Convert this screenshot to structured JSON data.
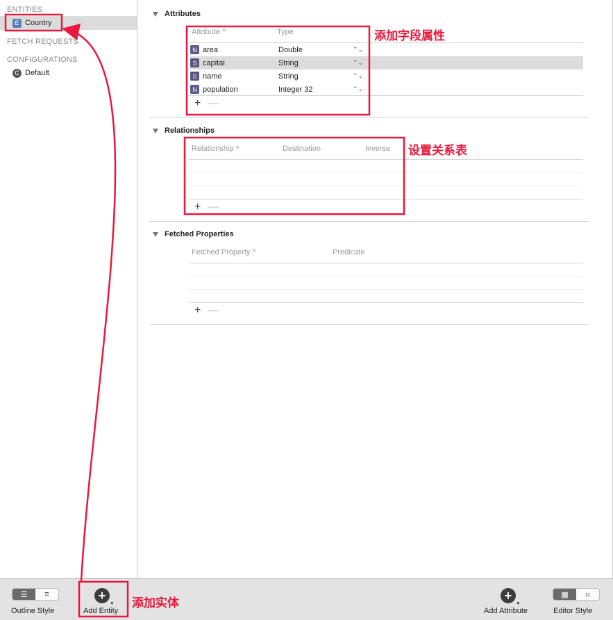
{
  "sidebar": {
    "entities_header": "ENTITIES",
    "entities": [
      {
        "label": "Country",
        "badge": "E",
        "selected": true
      }
    ],
    "fetch_requests_header": "FETCH REQUESTS",
    "configurations_header": "CONFIGURATIONS",
    "configurations": [
      {
        "label": "Default",
        "badge": "C"
      }
    ]
  },
  "attributes": {
    "title": "Attributes",
    "columns": [
      "Attribute",
      "Type"
    ],
    "rows": [
      {
        "badge": "N",
        "name": "area",
        "type": "Double"
      },
      {
        "badge": "S",
        "name": "capital",
        "type": "String",
        "selected": true
      },
      {
        "badge": "S",
        "name": "name",
        "type": "String"
      },
      {
        "badge": "N",
        "name": "population",
        "type": "Integer 32"
      }
    ],
    "add": "+",
    "remove": "—"
  },
  "relationships": {
    "title": "Relationships",
    "columns": [
      "Relationship",
      "Destination",
      "Inverse"
    ],
    "add": "+",
    "remove": "—"
  },
  "fetched": {
    "title": "Fetched Properties",
    "columns": [
      "Fetched Property",
      "Predicate"
    ],
    "add": "+",
    "remove": "—"
  },
  "sort_indicator": "^",
  "stepper_icon": "⌃⌄",
  "toolbar": {
    "outline_style": "Outline Style",
    "add_entity": "Add Entity",
    "add_attribute": "Add Attribute",
    "editor_style": "Editor Style"
  },
  "annotations": {
    "attributes": "添加字段属性",
    "relationships": "设置关系表",
    "add_entity": "添加实体",
    "color": "#e8193c"
  }
}
